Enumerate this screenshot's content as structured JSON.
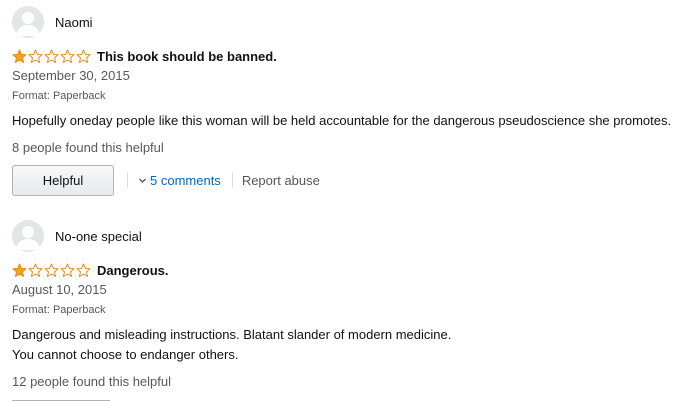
{
  "reviews": [
    {
      "author": "Naomi",
      "rating": 1,
      "rating_max": 5,
      "title": "This book should be banned.",
      "date": "September 30, 2015",
      "format": "Format: Paperback",
      "body": [
        "Hopefully oneday people like this woman will be held accountable for the dangerous pseudoscience she promotes."
      ],
      "helpful_count": "8 people found this helpful",
      "helpful_button": "Helpful",
      "comments_link": "5 comments",
      "report_link": "Report abuse"
    },
    {
      "author": "No-one special",
      "rating": 1,
      "rating_max": 5,
      "title": "Dangerous.",
      "date": "August 10, 2015",
      "format": "Format: Paperback",
      "body": [
        "Dangerous and misleading instructions. Blatant slander of modern medicine.",
        "You cannot choose to endanger others."
      ],
      "helpful_count": "12 people found this helpful"
    }
  ],
  "colors": {
    "star_filled": "#f4a41c",
    "star_empty_stroke": "#de8d1e",
    "link": "#0066c0",
    "muted": "#565959"
  },
  "icons": {
    "avatar": "default-user-avatar-icon",
    "star": "star-icon",
    "chevron": "chevron-down-icon"
  }
}
